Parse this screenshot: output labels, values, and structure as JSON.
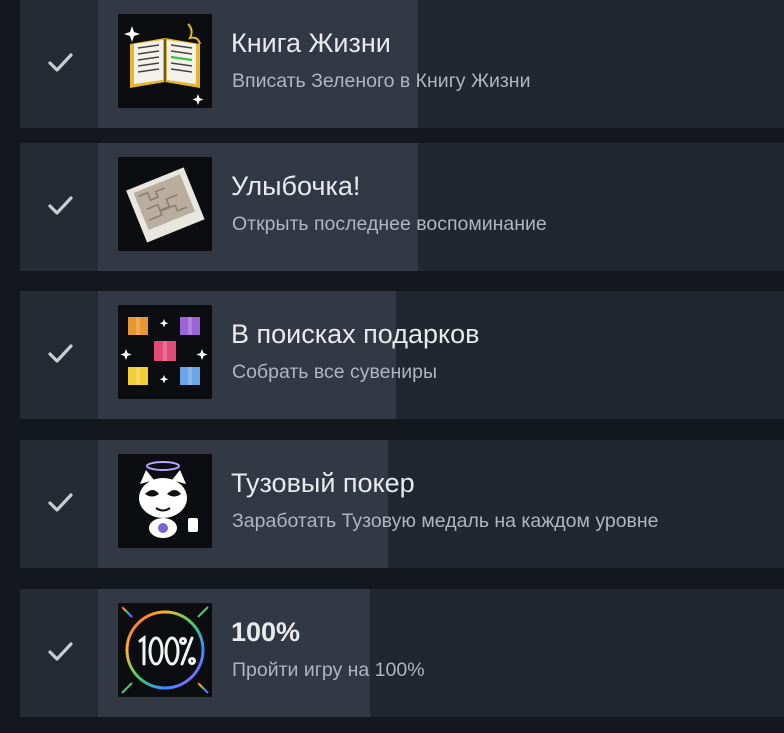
{
  "achievements": [
    {
      "title": "Книга Жизни",
      "description": "Вписать Зеленого в Книгу Жизни",
      "icon": "book-of-life-icon",
      "unlocked": true
    },
    {
      "title": "Улыбочка!",
      "description": "Открыть последнее воспоминание",
      "icon": "photo-memory-icon",
      "unlocked": true
    },
    {
      "title": "В поисках подарков",
      "description": "Собрать все сувениры",
      "icon": "gift-boxes-icon",
      "unlocked": true
    },
    {
      "title": "Тузовый покер",
      "description": "Заработать Тузовую медаль на каждом уровне",
      "icon": "ace-cat-icon",
      "unlocked": true
    },
    {
      "title": "100%",
      "description": "Пройти игру на 100%",
      "icon": "hundred-percent-icon",
      "unlocked": true
    }
  ],
  "colors": {
    "background": "#14171d",
    "row": "#222630",
    "highlight": "#333845",
    "title": "#e8eaee",
    "description": "#b0b5c0",
    "check": "#c9ccd2"
  }
}
